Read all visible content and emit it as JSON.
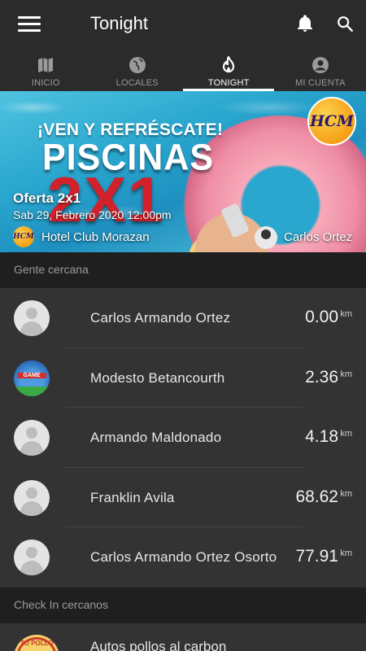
{
  "app_bar": {
    "title": "Tonight"
  },
  "tabs": [
    {
      "label": "INICIO",
      "icon": "map-icon"
    },
    {
      "label": "LOCALES",
      "icon": "globe-icon"
    },
    {
      "label": "TONIGHT",
      "icon": "flame-icon",
      "active": true
    },
    {
      "label": "MI CUENTA",
      "icon": "account-icon"
    }
  ],
  "featured": {
    "slogan": "¡VEN Y REFRÉSCATE!",
    "headline": "PISCINAS",
    "promo": "2X1",
    "logo_text": "HCM",
    "offer_title": "Oferta 2x1",
    "offer_date": "Sab 29, Febrero 2020 12:00pm",
    "venue": "Hotel Club Morazan",
    "host": "Carlos Ortez"
  },
  "nearby_people": {
    "header": "Gente cercana",
    "unit": "km",
    "items": [
      {
        "name": "Carlos Armando Ortez",
        "distance": "0.00",
        "avatar": "default"
      },
      {
        "name": "Modesto Betancourth",
        "distance": "2.36",
        "avatar": "game",
        "avatar_text": "GAME"
      },
      {
        "name": "Armando Maldonado",
        "distance": "4.18",
        "avatar": "default"
      },
      {
        "name": "Franklin Avila",
        "distance": "68.62",
        "avatar": "default"
      },
      {
        "name": "Carlos Armando Ortez Osorto",
        "distance": "77.91",
        "avatar": "default"
      }
    ]
  },
  "nearby_checkins": {
    "header": "Check In cercanos",
    "items": [
      {
        "name": "Autos pollos al carbon",
        "logo_text": "TO POLLO"
      }
    ]
  },
  "colors": {
    "background": "#262626",
    "appbar": "#2b2b2b",
    "list_bg": "#333333",
    "promo_red": "#d3212b"
  }
}
